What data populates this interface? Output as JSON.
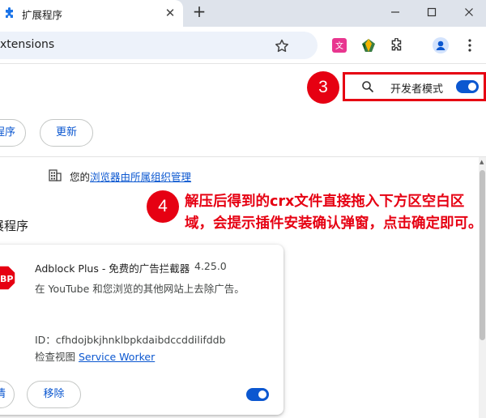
{
  "tab": {
    "title": "扩展程序",
    "close": "✕"
  },
  "new_tab": "+",
  "window_controls": {
    "minimize": "─",
    "maximize": "☐",
    "close": "✕"
  },
  "omnibox": {
    "url": "xtensions"
  },
  "toolbar_icons": {
    "translate_ext": "translate-extension-icon",
    "gem_ext": "gem-extension-icon",
    "extensions": "puzzle-icon",
    "profile": "profile-icon",
    "menu": "three-dots-menu-icon"
  },
  "header": {
    "dev_mode_label": "开发者模式",
    "dev_mode_on": true
  },
  "badges": {
    "step3": "3",
    "step4": "4"
  },
  "actions": {
    "programs_label": "程序",
    "update_label": "更新"
  },
  "managed": {
    "prefix": "您的",
    "link": "浏览器由所属组织管理"
  },
  "section_title": "展程序",
  "annotation": "解压后得到的crx文件直接拖入下方区空白区域，会提示插件安装确认弹窗，点击确定即可。",
  "extension": {
    "name": "Adblock Plus - 免费的广告拦截器",
    "version": "4.25.0",
    "description": "在 YouTube 和您浏览的其他网站上去除广告。",
    "id_line": "ID：cfhdojbkjhnklbpkdaibdccddilifddb",
    "inspect_prefix": "检查视图",
    "service_worker": "Service Worker",
    "details_label": "情",
    "remove_label": "移除",
    "enabled": true
  },
  "colors": {
    "accent": "#0b57d0",
    "annotation_red": "#e60012",
    "tabstrip": "#dee3eb",
    "omnibox": "#edf2fa"
  }
}
